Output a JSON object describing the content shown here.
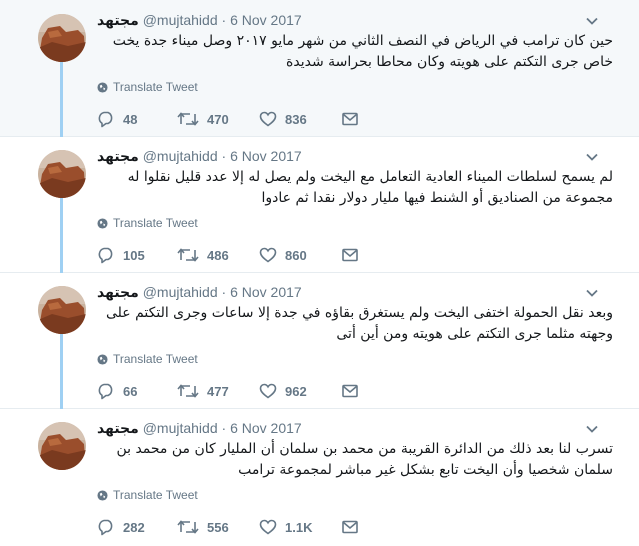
{
  "tweets": [
    {
      "name": "مجتهد",
      "handle": "@mujtahidd",
      "separator": "·",
      "date": "6 Nov 2017",
      "text": "حين كان ترامب في الرياض في النصف الثاني من شهر مايو ٢٠١٧ وصل ميناء جدة يخت خاص جرى التكتم على هويته وكان محاطا بحراسة شديدة",
      "translate": "Translate Tweet",
      "replies": "48",
      "retweets": "470",
      "likes": "836"
    },
    {
      "name": "مجتهد",
      "handle": "@mujtahidd",
      "separator": "·",
      "date": "6 Nov 2017",
      "text": "لم يسمح لسلطات الميناء العادية التعامل مع اليخت ولم يصل له إلا عدد قليل نقلوا له مجموعة من الصناديق أو الشنط فيها مليار دولار نقدا ثم عادوا",
      "translate": "Translate Tweet",
      "replies": "105",
      "retweets": "486",
      "likes": "860"
    },
    {
      "name": "مجتهد",
      "handle": "@mujtahidd",
      "separator": "·",
      "date": "6 Nov 2017",
      "text": "وبعد نقل الحمولة اختفى اليخت ولم يستغرق بقاؤه في جدة إلا ساعات وجرى التكتم على وجهته مثلما جرى التكتم على هويته ومن أين أتى",
      "translate": "Translate Tweet",
      "replies": "66",
      "retweets": "477",
      "likes": "962"
    },
    {
      "name": "مجتهد",
      "handle": "@mujtahidd",
      "separator": "·",
      "date": "6 Nov 2017",
      "text": "تسرب لنا بعد ذلك من الدائرة القريبة من محمد بن سلمان أن المليار كان من محمد بن سلمان شخصيا وأن اليخت تابع بشكل غير مباشر لمجموعة ترامب",
      "translate": "Translate Tweet",
      "replies": "282",
      "retweets": "556",
      "likes": "1.1K"
    }
  ],
  "colors": {
    "thread_line": "#9fd0f3",
    "first_tweet_bg": "#f5f8fa",
    "muted": "#657786",
    "text": "#14171a"
  },
  "icons": {
    "avatar": "desert-rock-avatar",
    "menu": "chevron-down-icon",
    "translate": "globe-icon",
    "reply": "reply-icon",
    "retweet": "retweet-icon",
    "like": "heart-icon",
    "message": "envelope-icon"
  }
}
